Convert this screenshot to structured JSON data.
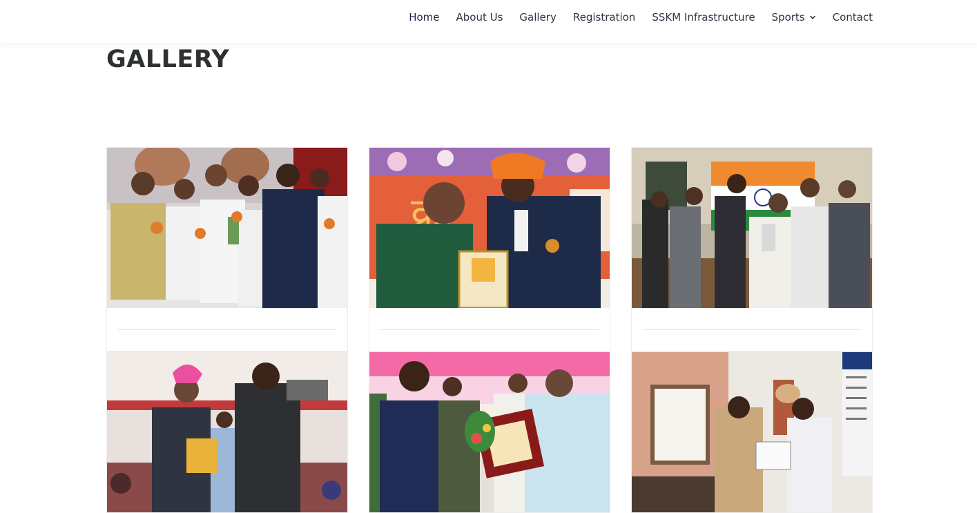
{
  "nav": {
    "items": [
      {
        "label": "Home",
        "active": true
      },
      {
        "label": "About Us"
      },
      {
        "label": "Gallery"
      },
      {
        "label": "Registration"
      },
      {
        "label": "SSKM Infrastructure"
      },
      {
        "label": "Sports",
        "has_dropdown": true
      },
      {
        "label": "Contact"
      }
    ]
  },
  "page": {
    "title": "GALLERY"
  },
  "gallery": {
    "photos": [
      {
        "scene": "award-ceremony-group-stage"
      },
      {
        "scene": "certificate-presentation-floral-turban"
      },
      {
        "scene": "indian-flag-trophy-group"
      },
      {
        "scene": "pink-turban-certificate-tent"
      },
      {
        "scene": "plaque-presentation-bouquet"
      },
      {
        "scene": "police-station-certificate"
      }
    ]
  },
  "colors": {
    "nav_text": "#2f3542",
    "nav_active": "#1f2a44",
    "title": "#2e3133",
    "card_border": "#ececec"
  }
}
